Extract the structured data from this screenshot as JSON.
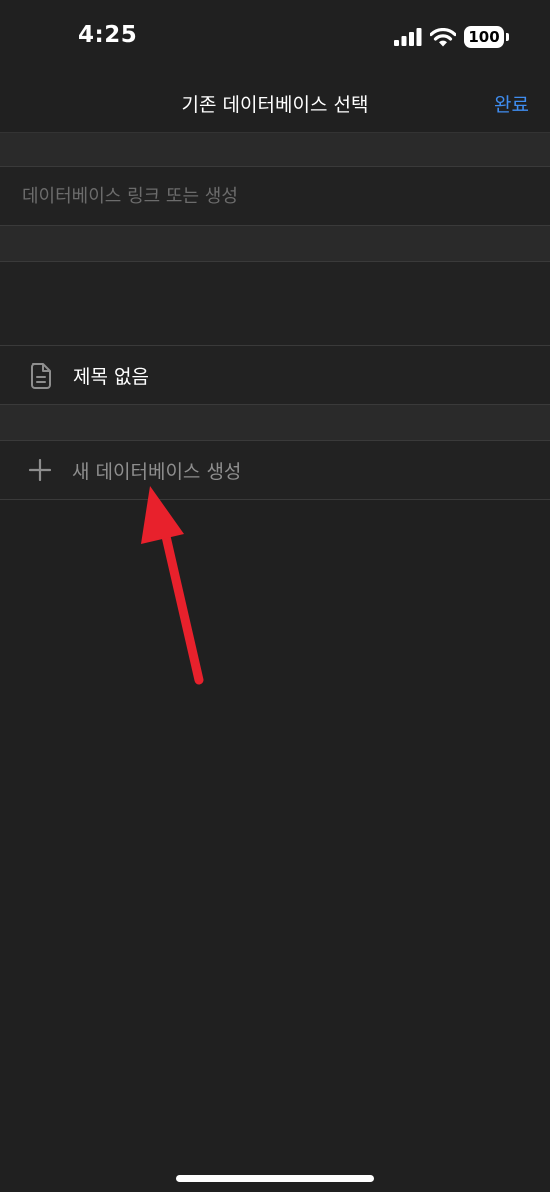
{
  "status_bar": {
    "time": "4:25",
    "battery": "100",
    "icons": [
      "signal-icon",
      "wifi-icon",
      "battery-icon"
    ]
  },
  "nav": {
    "title": "기존 데이터베이스 선택",
    "done_label": "완료"
  },
  "search": {
    "placeholder": "데이터베이스 링크 또는 생성",
    "value": ""
  },
  "databases": [
    {
      "icon": "document-icon",
      "label": "제목 없음"
    }
  ],
  "create": {
    "icon": "plus-icon",
    "label": "새 데이터베이스 생성"
  },
  "colors": {
    "background": "#202020",
    "accent": "#3f8df0",
    "secondary_text": "#8e8e8e",
    "annotation_arrow": "#e8212c"
  },
  "annotation": {
    "type": "arrow",
    "points_to": "create-database-row"
  }
}
